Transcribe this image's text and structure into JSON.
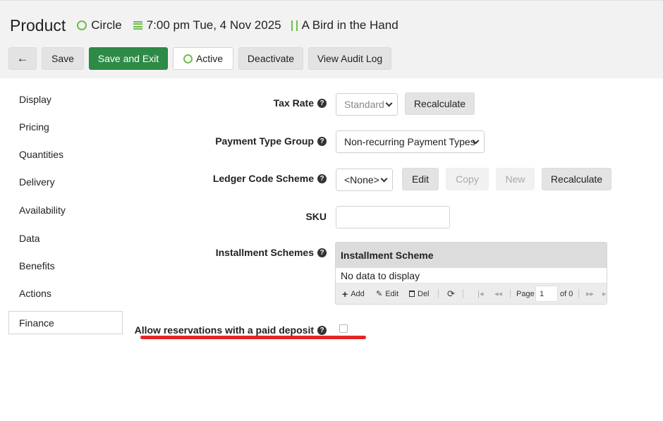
{
  "header": {
    "title": "Product",
    "shape": "Circle",
    "datetime": "7:00 pm Tue, 4 Nov 2025",
    "venue": "A Bird in the Hand"
  },
  "toolbar": {
    "back_icon": "←",
    "save": "Save",
    "save_exit": "Save and Exit",
    "active": "Active",
    "deactivate": "Deactivate",
    "audit": "View Audit Log"
  },
  "sidebar": {
    "items": [
      {
        "label": "Display"
      },
      {
        "label": "Pricing"
      },
      {
        "label": "Quantities"
      },
      {
        "label": "Delivery"
      },
      {
        "label": "Availability"
      },
      {
        "label": "Data"
      },
      {
        "label": "Benefits"
      },
      {
        "label": "Actions"
      },
      {
        "label": "Finance"
      }
    ],
    "active": "Finance"
  },
  "form": {
    "tax_rate": {
      "label": "Tax Rate",
      "value": "Standard",
      "recalc": "Recalculate"
    },
    "payment_type_group": {
      "label": "Payment Type Group",
      "value": "Non-recurring Payment Types"
    },
    "ledger_code_scheme": {
      "label": "Ledger Code Scheme",
      "value": "<None>",
      "edit": "Edit",
      "copy": "Copy",
      "new": "New",
      "recalc": "Recalculate"
    },
    "sku": {
      "label": "SKU",
      "value": ""
    },
    "installment_schemes": {
      "label": "Installment Schemes",
      "column": "Installment Scheme",
      "empty": "No data to display",
      "pager": {
        "add": "Add",
        "edit": "Edit",
        "del": "Del",
        "page_label": "Page",
        "page": "1",
        "of": "of 0"
      }
    },
    "paid_deposit": {
      "label": "Allow reservations with a paid deposit",
      "checked": false
    }
  },
  "help_glyph": "?",
  "colors": {
    "accent_green": "#6cc04a",
    "primary_button": "#2e8b47",
    "highlight_red": "#e52525"
  }
}
